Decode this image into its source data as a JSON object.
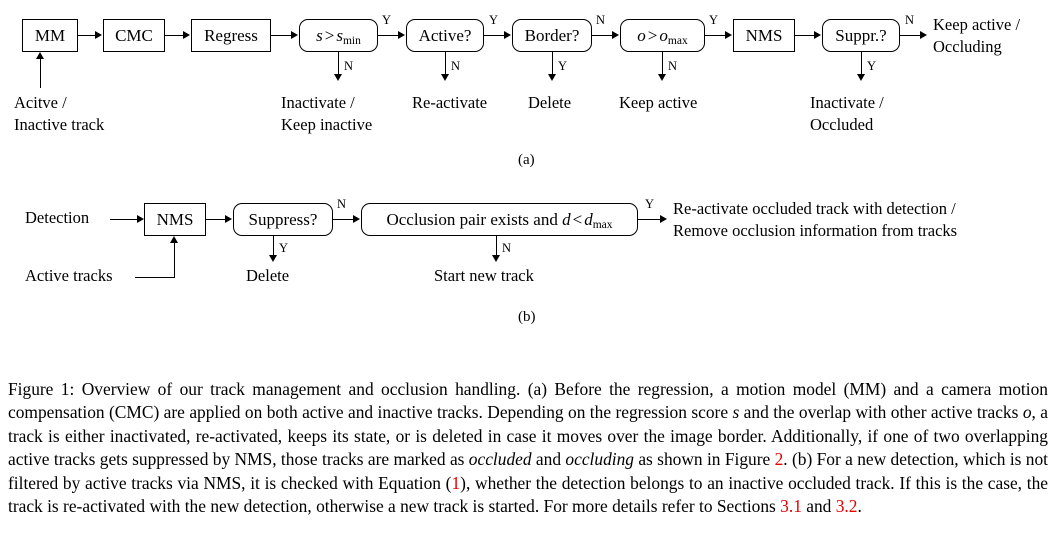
{
  "figure": {
    "label": "Figure 1",
    "subcaption_a": "(a)",
    "subcaption_b": "(b)"
  },
  "colors": {
    "text": "#000000",
    "reference_link": "#e60000",
    "box_border": "#000000",
    "background": "#ffffff"
  },
  "diagram_a": {
    "nodes": [
      {
        "id": "mm",
        "label": "MM",
        "shape": "rect"
      },
      {
        "id": "cmc",
        "label": "CMC",
        "shape": "rect"
      },
      {
        "id": "regress",
        "label": "Regress",
        "shape": "rect"
      },
      {
        "id": "score",
        "label": "s > smin",
        "shape": "rounded",
        "var": "s",
        "op": ">",
        "var2": "s",
        "sub2": "min"
      },
      {
        "id": "active",
        "label": "Active?",
        "shape": "rounded"
      },
      {
        "id": "border",
        "label": "Border?",
        "shape": "rounded"
      },
      {
        "id": "overlap",
        "label": "o > omax",
        "shape": "rounded",
        "var": "o",
        "op": ">",
        "var2": "o",
        "sub2": "max"
      },
      {
        "id": "nms",
        "label": "NMS",
        "shape": "rect"
      },
      {
        "id": "suppr",
        "label": "Suppr.?",
        "shape": "rounded"
      }
    ],
    "edge_labels": {
      "score_no": "N",
      "active_yes": "Y",
      "active_no": "N",
      "border_yes": "Y",
      "border_no": "N",
      "overlap_yes": "Y",
      "overlap_no": "N",
      "suppr_yes": "Y",
      "suppr_no": "N"
    },
    "input_label": {
      "line1": "Acitve /",
      "line2": "Inactive track"
    },
    "outcomes": [
      {
        "id": "out-inactivate",
        "line1": "Inactivate /",
        "line2": "Keep inactive"
      },
      {
        "id": "out-reactivate",
        "line1": "Re-activate",
        "line2": ""
      },
      {
        "id": "out-delete",
        "line1": "Delete",
        "line2": ""
      },
      {
        "id": "out-keepactive",
        "line1": "Keep active",
        "line2": ""
      },
      {
        "id": "out-inactocc",
        "line1": "Inactivate /",
        "line2": "Occluded"
      },
      {
        "id": "out-keepactocc",
        "line1": "Keep active /",
        "line2": "Occluding"
      }
    ]
  },
  "diagram_b": {
    "nodes": [
      {
        "id": "nms-b",
        "label": "NMS",
        "shape": "rect"
      },
      {
        "id": "suppress-b",
        "label": "Suppress?",
        "shape": "rounded"
      },
      {
        "id": "occpair-b",
        "label": "Occlusion pair exists and d < dmax",
        "shape": "rounded",
        "prefix": "Occlusion pair exists and ",
        "var": "d",
        "op": "<",
        "var2": "d",
        "sub2": "max"
      }
    ],
    "edge_labels": {
      "suppress_yes": "Y",
      "suppress_no": "N",
      "occpair_yes": "Y",
      "occpair_no": "N"
    },
    "inputs": [
      {
        "id": "in-detection",
        "label": "Detection"
      },
      {
        "id": "in-activetracks",
        "label": "Active tracks"
      }
    ],
    "outcomes": [
      {
        "id": "outb-delete",
        "line1": "Delete",
        "line2": ""
      },
      {
        "id": "outb-newtrack",
        "line1": "Start new track",
        "line2": ""
      },
      {
        "id": "outb-reactivate",
        "line1": "Re-activate occluded track with detection /",
        "line2": "Remove occlusion information from tracks"
      }
    ]
  },
  "caption": {
    "seg1": "Figure 1: Overview of our track management and occlusion handling. (a) Before the regression, a motion model (MM) and a camera motion compensation (CMC) are applied on both active and inactive tracks. Depending on the regression score ",
    "math_s": "s",
    "seg2": " and the overlap with other active tracks ",
    "math_o": "o",
    "seg3": ", a track is either inactivated, re-activated, keeps its state, or is deleted in case it moves over the image border. Additionally, if one of two overlapping active tracks gets suppressed by NMS, those tracks are marked as ",
    "italic_occluded": "occluded",
    "seg4": " and ",
    "italic_occluding": "occluding",
    "seg5": " as shown in Figure ",
    "ref_fig2": "2",
    "seg6": ". (b) For a new detection, which is not filtered by active tracks via NMS, it is checked with Equation (",
    "ref_eq1": "1",
    "seg7": "), whether the detection belongs to an inactive occluded track. If this is the case, the track is re-activated with the new detection, otherwise a new track is started. For more details refer to Sections ",
    "ref_sec31": "3.1",
    "seg8": " and ",
    "ref_sec32": "3.2",
    "seg9": "."
  }
}
